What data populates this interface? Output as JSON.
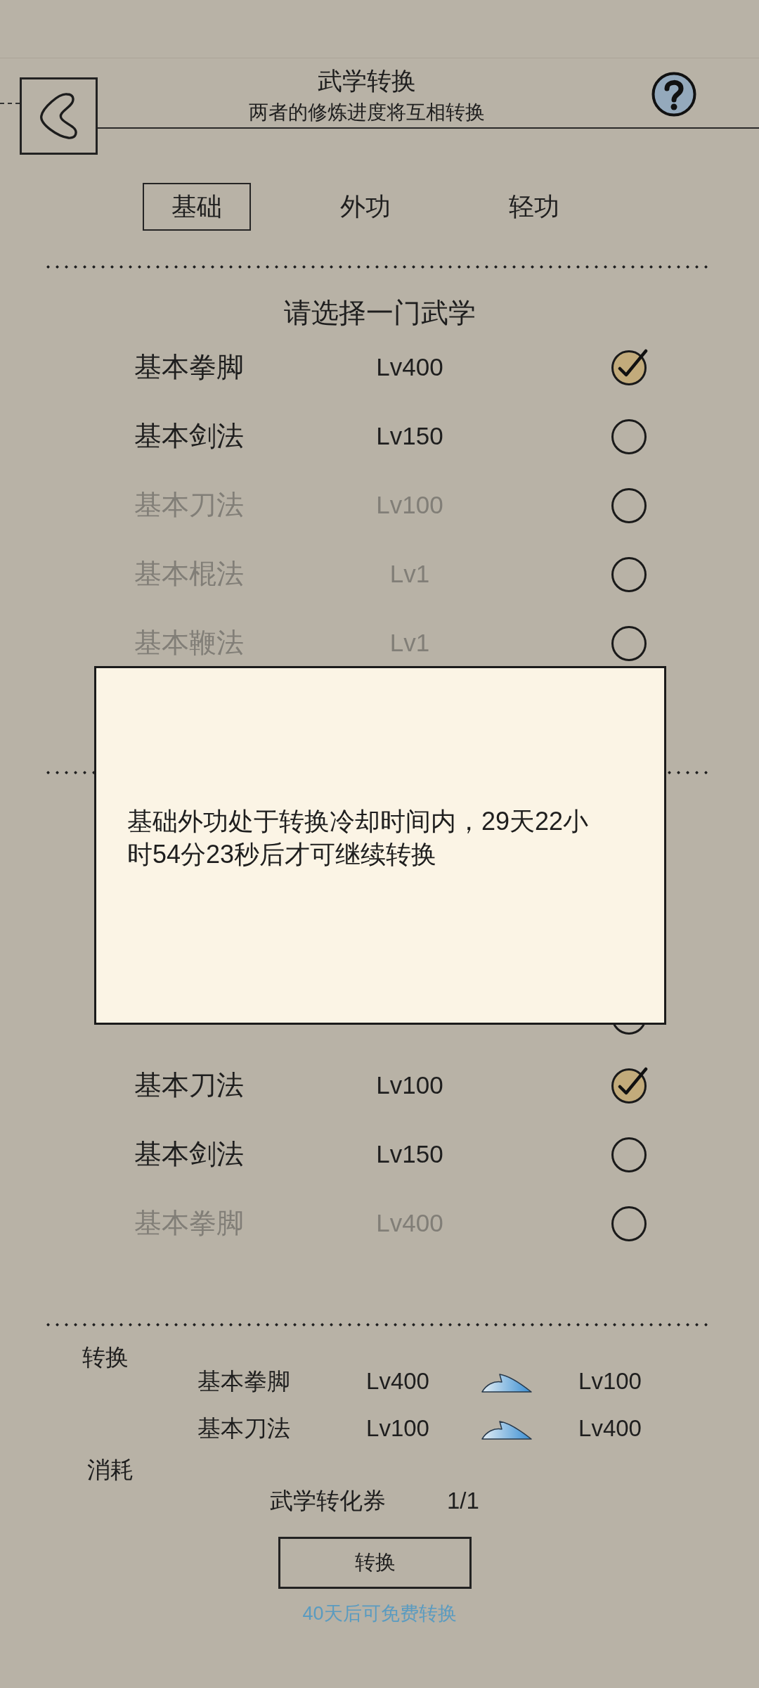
{
  "header": {
    "title": "武学转换",
    "subtitle": "两者的修炼进度将互相转换"
  },
  "tabs": [
    {
      "label": "基础",
      "selected": true
    },
    {
      "label": "外功",
      "selected": false
    },
    {
      "label": "轻功",
      "selected": false
    }
  ],
  "skill_picker": {
    "prompt": "请选择一门武学",
    "items": [
      {
        "name": "基本拳脚",
        "level_label": "Lv400",
        "selected": true,
        "disabled": false
      },
      {
        "name": "基本剑法",
        "level_label": "Lv150",
        "selected": false,
        "disabled": false
      },
      {
        "name": "基本刀法",
        "level_label": "Lv100",
        "selected": false,
        "disabled": true
      },
      {
        "name": "基本棍法",
        "level_label": "Lv1",
        "selected": false,
        "disabled": true
      },
      {
        "name": "基本鞭法",
        "level_label": "Lv1",
        "selected": false,
        "disabled": true
      }
    ]
  },
  "target_picker": {
    "items": [
      {
        "selected": false
      },
      {
        "name": "基本刀法",
        "level_label": "Lv100",
        "selected": true,
        "disabled": false
      },
      {
        "name": "基本剑法",
        "level_label": "Lv150",
        "selected": false,
        "disabled": false
      },
      {
        "name": "基本拳脚",
        "level_label": "Lv400",
        "selected": false,
        "disabled": true
      }
    ]
  },
  "conversion": {
    "label": "转换",
    "rows": [
      {
        "skill": "基本拳脚",
        "from": "Lv400",
        "to": "Lv100"
      },
      {
        "skill": "基本刀法",
        "from": "Lv100",
        "to": "Lv400"
      }
    ]
  },
  "cost": {
    "label": "消耗",
    "item": "武学转化券",
    "count": "1/1"
  },
  "convert_button": {
    "label": "转换"
  },
  "free_note": "40天后可免费转换",
  "dialog": {
    "message": "基础外功处于转换冷却时间内，29天22小时54分23秒后才可继续转换"
  }
}
